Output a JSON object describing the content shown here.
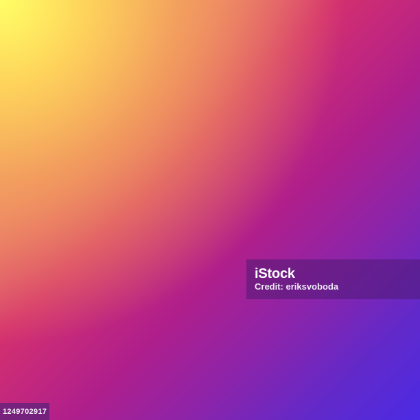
{
  "watermark": {
    "brand": "iStock",
    "credit": "Credit: eriksvoboda"
  },
  "image_id": "1249702917",
  "colors": {
    "top_left": "#ffff66",
    "center": "#d4306f",
    "bottom_right": "#4b2be4",
    "watermark_bg": "#4e1973"
  }
}
